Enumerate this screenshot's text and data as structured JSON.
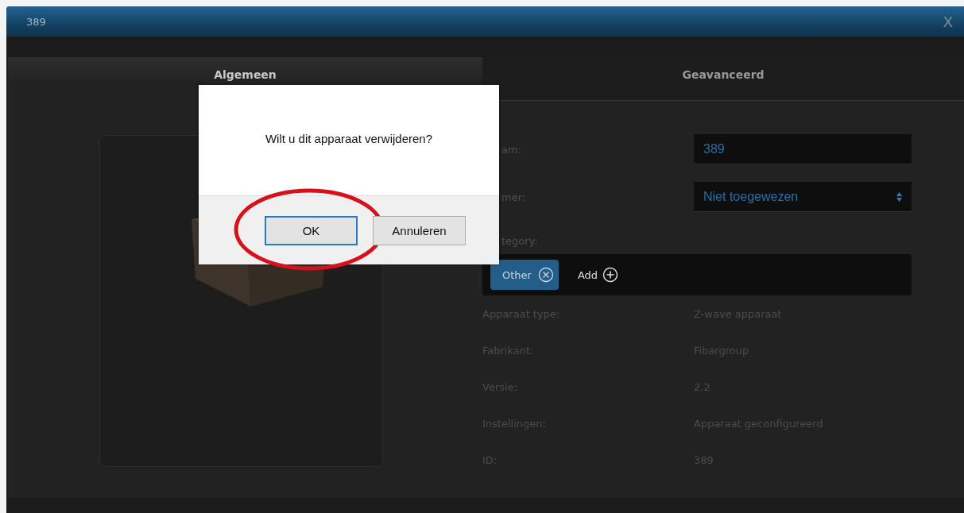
{
  "window": {
    "title": "389",
    "close": "X"
  },
  "tabs": [
    {
      "label": "Algemeen",
      "selected": true
    },
    {
      "label": "Geavanceerd",
      "selected": false
    }
  ],
  "form": {
    "fields": [
      {
        "kind": "input",
        "label": "am:",
        "value": "389"
      },
      {
        "kind": "select",
        "label": "mer:",
        "value": "Niet toegewezen"
      }
    ],
    "category": {
      "label": "tegory:",
      "tags": [
        {
          "label": "Other"
        }
      ],
      "add": "Add"
    },
    "info": [
      {
        "label": "Apparaat type:",
        "value": "Z-wave apparaat"
      },
      {
        "label": "Fabrikant:",
        "value": "Fibargroup"
      },
      {
        "label": "Versie:",
        "value": "2.2"
      },
      {
        "label": "Instellingen:",
        "value": "Apparaat geconfigureerd"
      },
      {
        "label": "ID:",
        "value": "389"
      }
    ]
  },
  "dialog": {
    "message": "Wilt u dit apparaat verwijderen?",
    "buttons": [
      {
        "label": "OK",
        "focused": true,
        "circled": true
      },
      {
        "label": "Annuleren",
        "focused": false,
        "circled": false
      }
    ]
  }
}
